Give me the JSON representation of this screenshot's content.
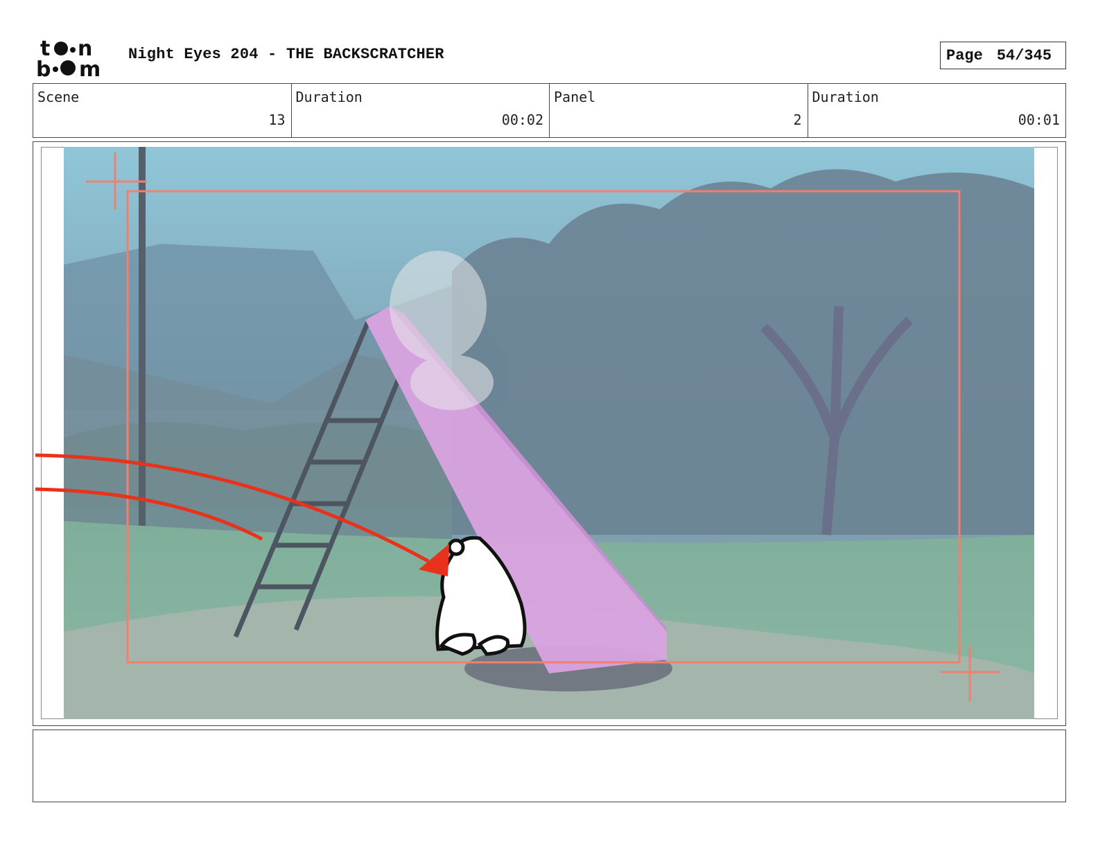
{
  "header": {
    "logo_text": "toon boom",
    "title": "Night Eyes 204 - THE BACKSCRATCHER",
    "page_label": "Page",
    "page_value": "54/345"
  },
  "info": {
    "scene_label": "Scene",
    "scene_value": "13",
    "scene_duration_label": "Duration",
    "scene_duration_value": "00:02",
    "panel_label": "Panel",
    "panel_value": "2",
    "panel_duration_label": "Duration",
    "panel_duration_value": "00:01"
  },
  "notes": {
    "text": ""
  },
  "colors": {
    "sky": "#8fbfcf",
    "slide": "#d9a3e0",
    "camera_frame": "#f08070",
    "arrow": "#e8321c"
  }
}
